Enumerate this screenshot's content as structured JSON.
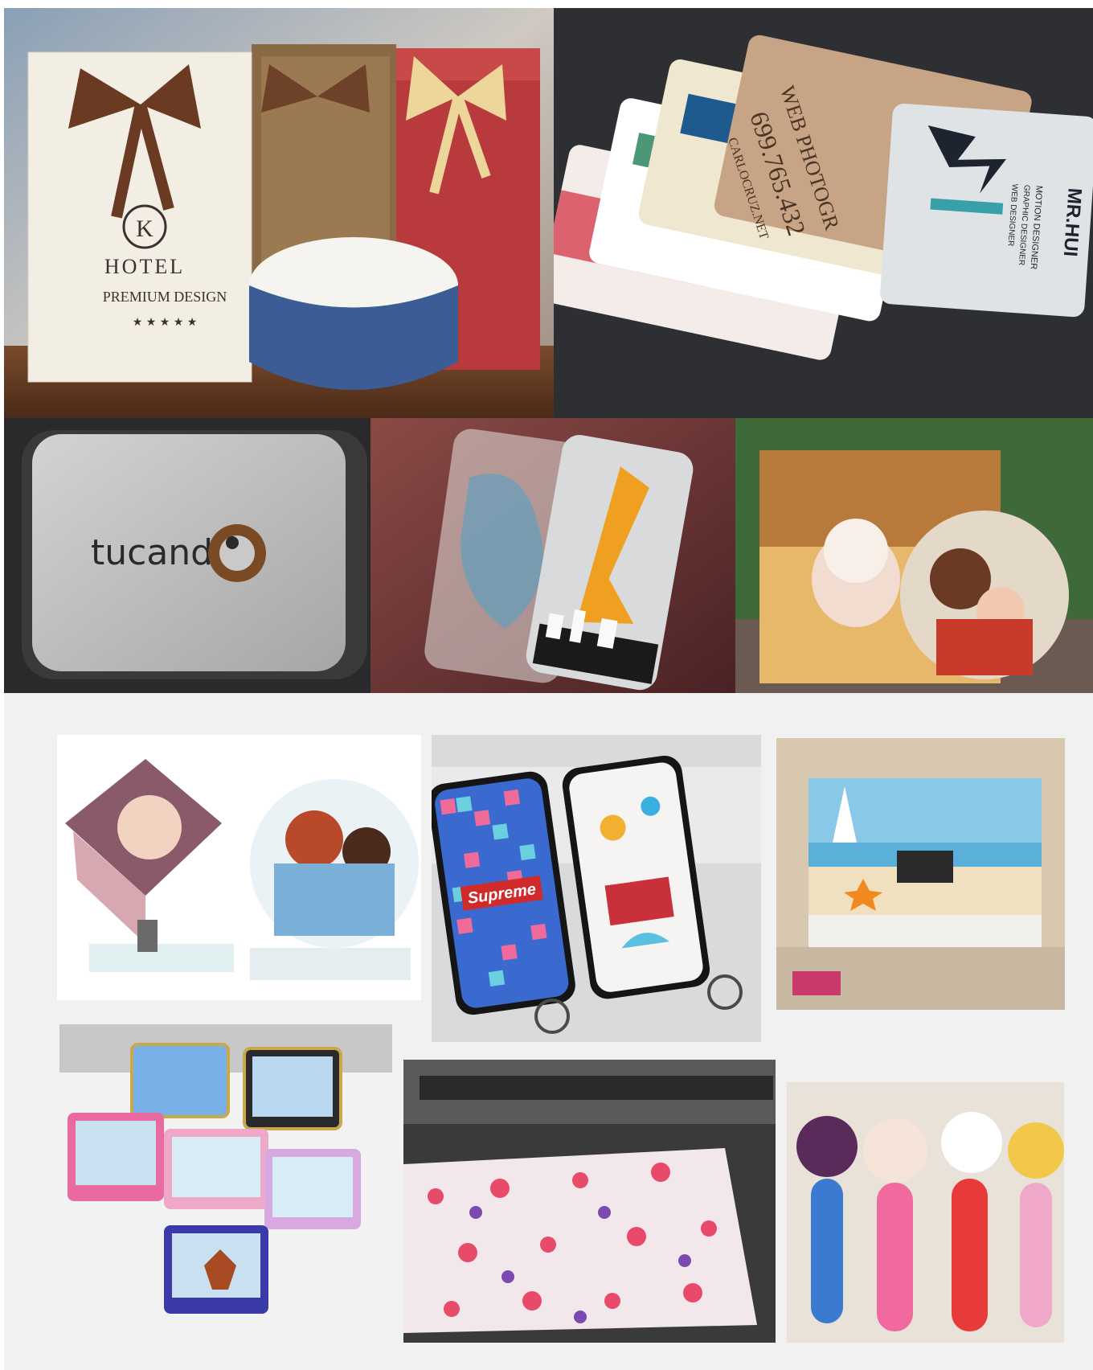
{
  "photos": {
    "gift_boxes": {
      "hotel_brand": "HOTEL",
      "brand_letter": "K",
      "tagline": "PREMIUM DESIGN",
      "stars": "★ ★ ★ ★ ★"
    },
    "business_cards": {
      "card_name": "MR.HUI",
      "card_role_1": "MOTION DESIGNER",
      "card_role_2": "GRAPHIC DESIGNER",
      "card_role_3": "WEB DESIGNER",
      "photo_heading": "WEB PHOTOGR",
      "phone": "699.765.432",
      "website": "CARLOCRUZ.NET"
    },
    "metal_tin": {
      "logo_text": "tucando"
    },
    "phone_cases_printed": {
      "case_label": "Supreme"
    }
  },
  "colors": {
    "background_bottom": "#f1f1f1",
    "tin_silver": "#b9b9b9",
    "desk_dark": "#2f2f33"
  }
}
